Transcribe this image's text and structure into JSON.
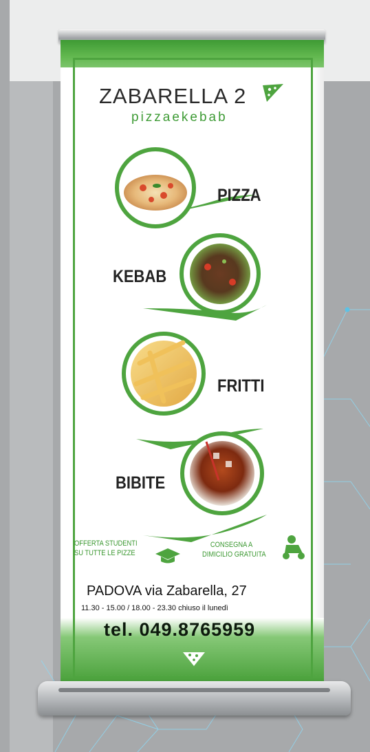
{
  "brand": {
    "name": "ZABARELLA 2",
    "tagline": "pizzaekebab",
    "color": "#4ea43f"
  },
  "menu": [
    {
      "label": "PIZZA",
      "icon": "pizza-photo"
    },
    {
      "label": "KEBAB",
      "icon": "kebab-photo"
    },
    {
      "label": "FRITTI",
      "icon": "fries-photo"
    },
    {
      "label": "BIBITE",
      "icon": "drink-photo"
    }
  ],
  "promos": {
    "students_line1": "OFFERTA STUDENTI",
    "students_line2": "SU TUTTE LE PIZZE",
    "delivery_line1": "CONSEGNA A",
    "delivery_line2": "DIMICILIO GRATUITA"
  },
  "contact": {
    "address": "PADOVA  via Zabarella, 27",
    "hours": "11.30 - 15.00 / 18.00 - 23.30  chiuso il lunedì",
    "phone": "tel. 049.8765959"
  }
}
